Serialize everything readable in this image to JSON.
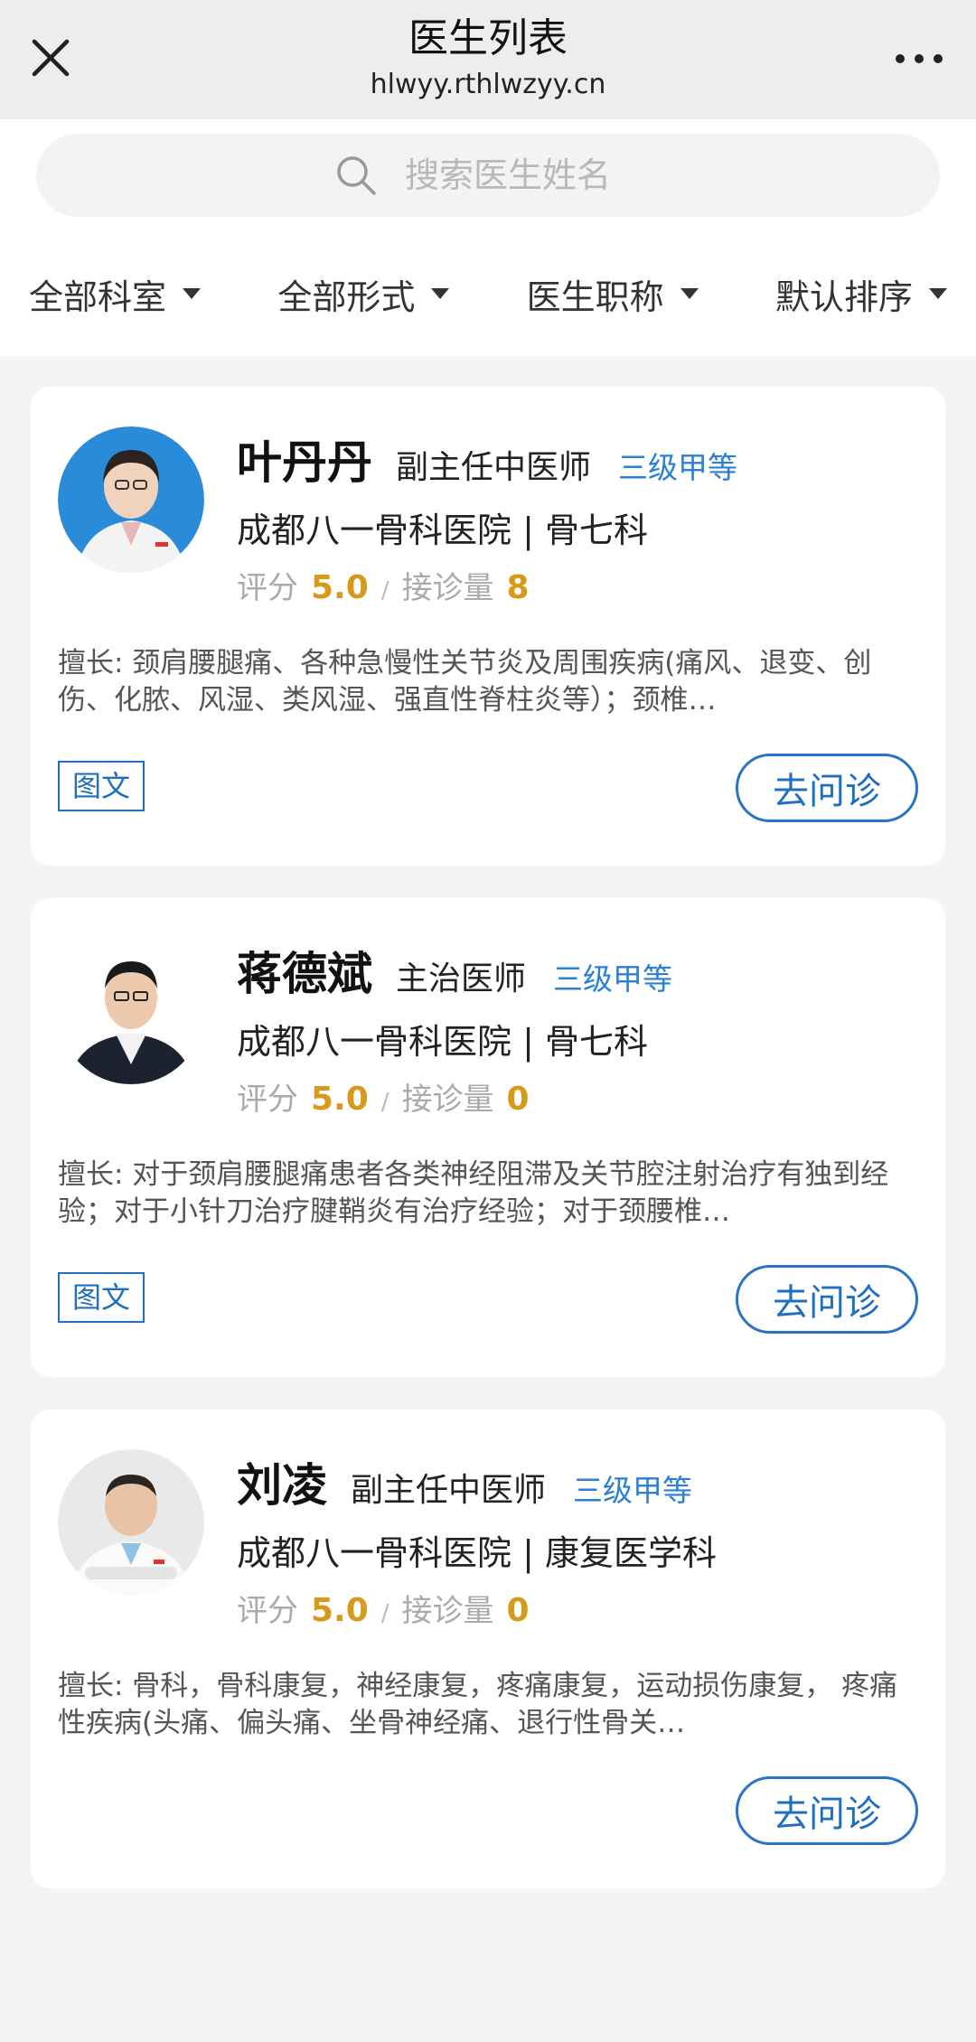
{
  "header": {
    "title": "医生列表",
    "subtitle": "hlwyy.rthlwzyy.cn",
    "close_icon": "close-icon",
    "more_icon": "more-icon"
  },
  "search": {
    "placeholder": "搜索医生姓名"
  },
  "filters": [
    {
      "label": "全部科室"
    },
    {
      "label": "全部形式"
    },
    {
      "label": "医生职称"
    },
    {
      "label": "默认排序"
    }
  ],
  "doctors": [
    {
      "name": "叶丹丹",
      "title": "副主任中医师",
      "grade": "三级甲等",
      "hospital": "成都八一骨科医院 | 骨七科",
      "rating_label": "评分",
      "rating": "5.0",
      "count_label": "接诊量",
      "count": "8",
      "desc": "擅长: 颈肩腰腿痛、各种急慢性关节炎及周围疾病(痛风、退变、创伤、化脓、风湿、类风湿、强直性脊柱炎等）；颈椎…",
      "tag": "图文",
      "button": "去问诊"
    },
    {
      "name": "蒋德斌",
      "title": "主治医师",
      "grade": "三级甲等",
      "hospital": "成都八一骨科医院 | 骨七科",
      "rating_label": "评分",
      "rating": "5.0",
      "count_label": "接诊量",
      "count": "0",
      "desc": "擅长: 对于颈肩腰腿痛患者各类神经阻滞及关节腔注射治疗有独到经验；对于小针刀治疗腱鞘炎有治疗经验；对于颈腰椎…",
      "tag": "图文",
      "button": "去问诊"
    },
    {
      "name": "刘凌",
      "title": "副主任中医师",
      "grade": "三级甲等",
      "hospital": "成都八一骨科医院 | 康复医学科",
      "rating_label": "评分",
      "rating": "5.0",
      "count_label": "接诊量",
      "count": "0",
      "desc": "擅长: 骨科，骨科康复，神经康复，疼痛康复，运动损伤康复， 疼痛性疾病(头痛、偏头痛、坐骨神经痛、退行性骨关…",
      "tag": "",
      "button": "去问诊"
    }
  ],
  "colors": {
    "accent": "#1f6fc1",
    "rating": "#d79a1b",
    "background": "#f4f4f4"
  }
}
